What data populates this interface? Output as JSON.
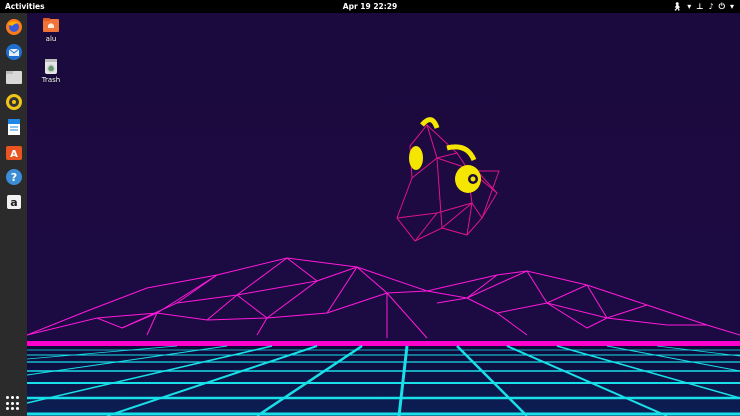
{
  "topbar": {
    "activities": "Activities",
    "clock": "Apr 19  22:29"
  },
  "dock": {
    "items": [
      {
        "name": "firefox",
        "icon": "firefox-icon"
      },
      {
        "name": "thunderbird",
        "icon": "mail-icon"
      },
      {
        "name": "files",
        "icon": "folder-icon"
      },
      {
        "name": "rhythmbox",
        "icon": "music-icon"
      },
      {
        "name": "writer",
        "icon": "document-icon"
      },
      {
        "name": "software",
        "icon": "store-icon"
      },
      {
        "name": "help",
        "icon": "help-icon"
      },
      {
        "name": "amazon",
        "icon": "amazon-icon"
      }
    ]
  },
  "desktop": {
    "icons": [
      {
        "label": "alu",
        "icon": "home-folder-icon"
      },
      {
        "label": "Trash",
        "icon": "trash-icon"
      }
    ]
  },
  "colors": {
    "accent": "#ff00cc",
    "grid": "#19e0e8",
    "background": "#1b0a3d",
    "cat_outline": "#e0148a",
    "yellow": "#f5e600"
  }
}
